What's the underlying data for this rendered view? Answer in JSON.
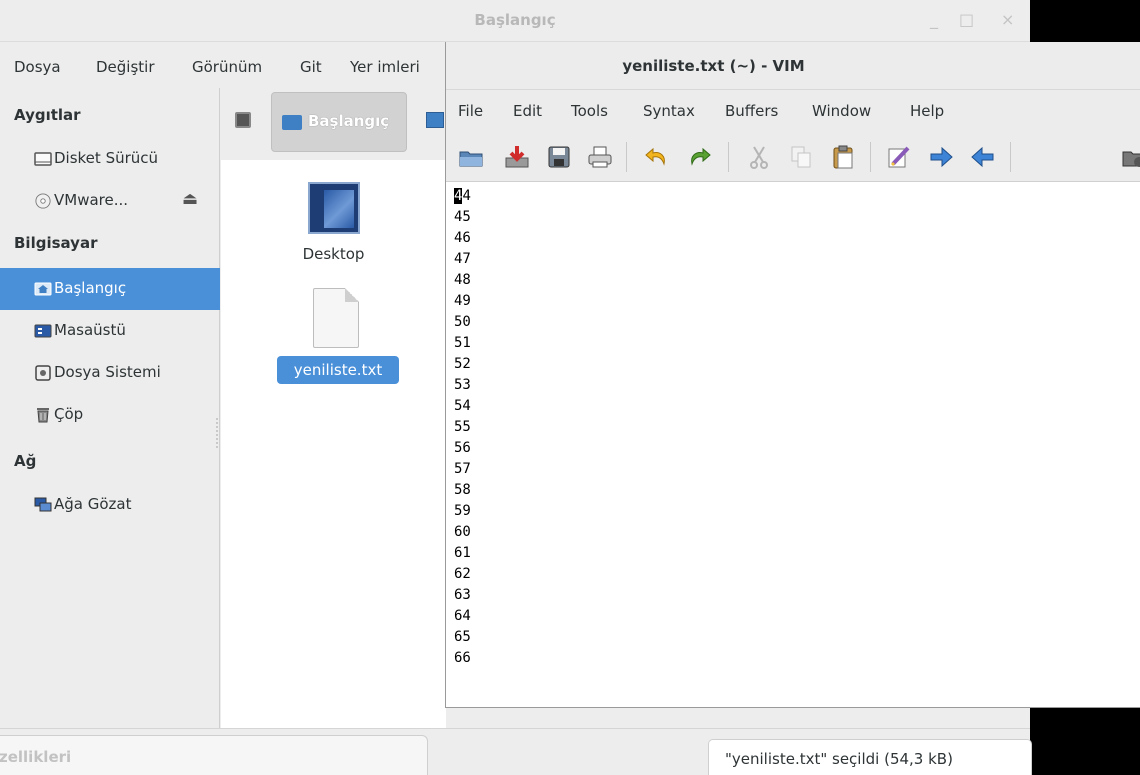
{
  "file_manager": {
    "title": "Başlangıç",
    "window_controls": {
      "minimize": "_",
      "maximize": "□",
      "close": "×"
    },
    "menu": [
      "Dosya",
      "Değiştir",
      "Görünüm",
      "Git",
      "Yer imleri"
    ],
    "sidebar": {
      "devices_heading": "Aygıtlar",
      "devices": [
        {
          "label": "Disket Sürücü",
          "icon": "floppy-icon"
        },
        {
          "label": "VMware...",
          "icon": "cdrom-icon",
          "eject": "⏏"
        }
      ],
      "computer_heading": "Bilgisayar",
      "computer": [
        {
          "label": "Başlangıç",
          "icon": "home-folder-icon",
          "active": true
        },
        {
          "label": "Masaüstü",
          "icon": "desktop-icon"
        },
        {
          "label": "Dosya Sistemi",
          "icon": "drive-icon"
        },
        {
          "label": "Çöp",
          "icon": "trash-icon"
        }
      ],
      "network_heading": "Ağ",
      "network": [
        {
          "label": "Ağa Gözat",
          "icon": "network-icon"
        }
      ]
    },
    "pathbar": {
      "current": "Başlangıç"
    },
    "files": [
      {
        "name": "Desktop",
        "icon": "desktop-folder-icon"
      },
      {
        "name": "yeniliste.txt",
        "icon": "text-file-icon",
        "selected": true
      }
    ],
    "properties_tab": "zellikleri",
    "status": "\"yeniliste.txt\" seçildi (54,3 kB)"
  },
  "vim": {
    "title": "yeniliste.txt (~) - VIM",
    "menu": [
      "File",
      "Edit",
      "Tools",
      "Syntax",
      "Buffers",
      "Window",
      "Help"
    ],
    "toolbar": [
      "open-icon",
      "save-download-icon",
      "save-icon",
      "print-icon",
      "undo-icon",
      "redo-icon",
      "cut-icon",
      "copy-icon",
      "paste-icon",
      "replace-icon",
      "find-next-icon",
      "find-prev-icon",
      "session-icon"
    ],
    "cursor_char": "4",
    "first_line_rest": "4",
    "lines": [
      "45",
      "46",
      "47",
      "48",
      "49",
      "50",
      "51",
      "52",
      "53",
      "54",
      "55",
      "56",
      "57",
      "58",
      "59",
      "60",
      "61",
      "62",
      "63",
      "64",
      "65",
      "66"
    ]
  },
  "colors": {
    "selection": "#4a90d9",
    "window_bg": "#ededed",
    "text": "#2e3436"
  }
}
